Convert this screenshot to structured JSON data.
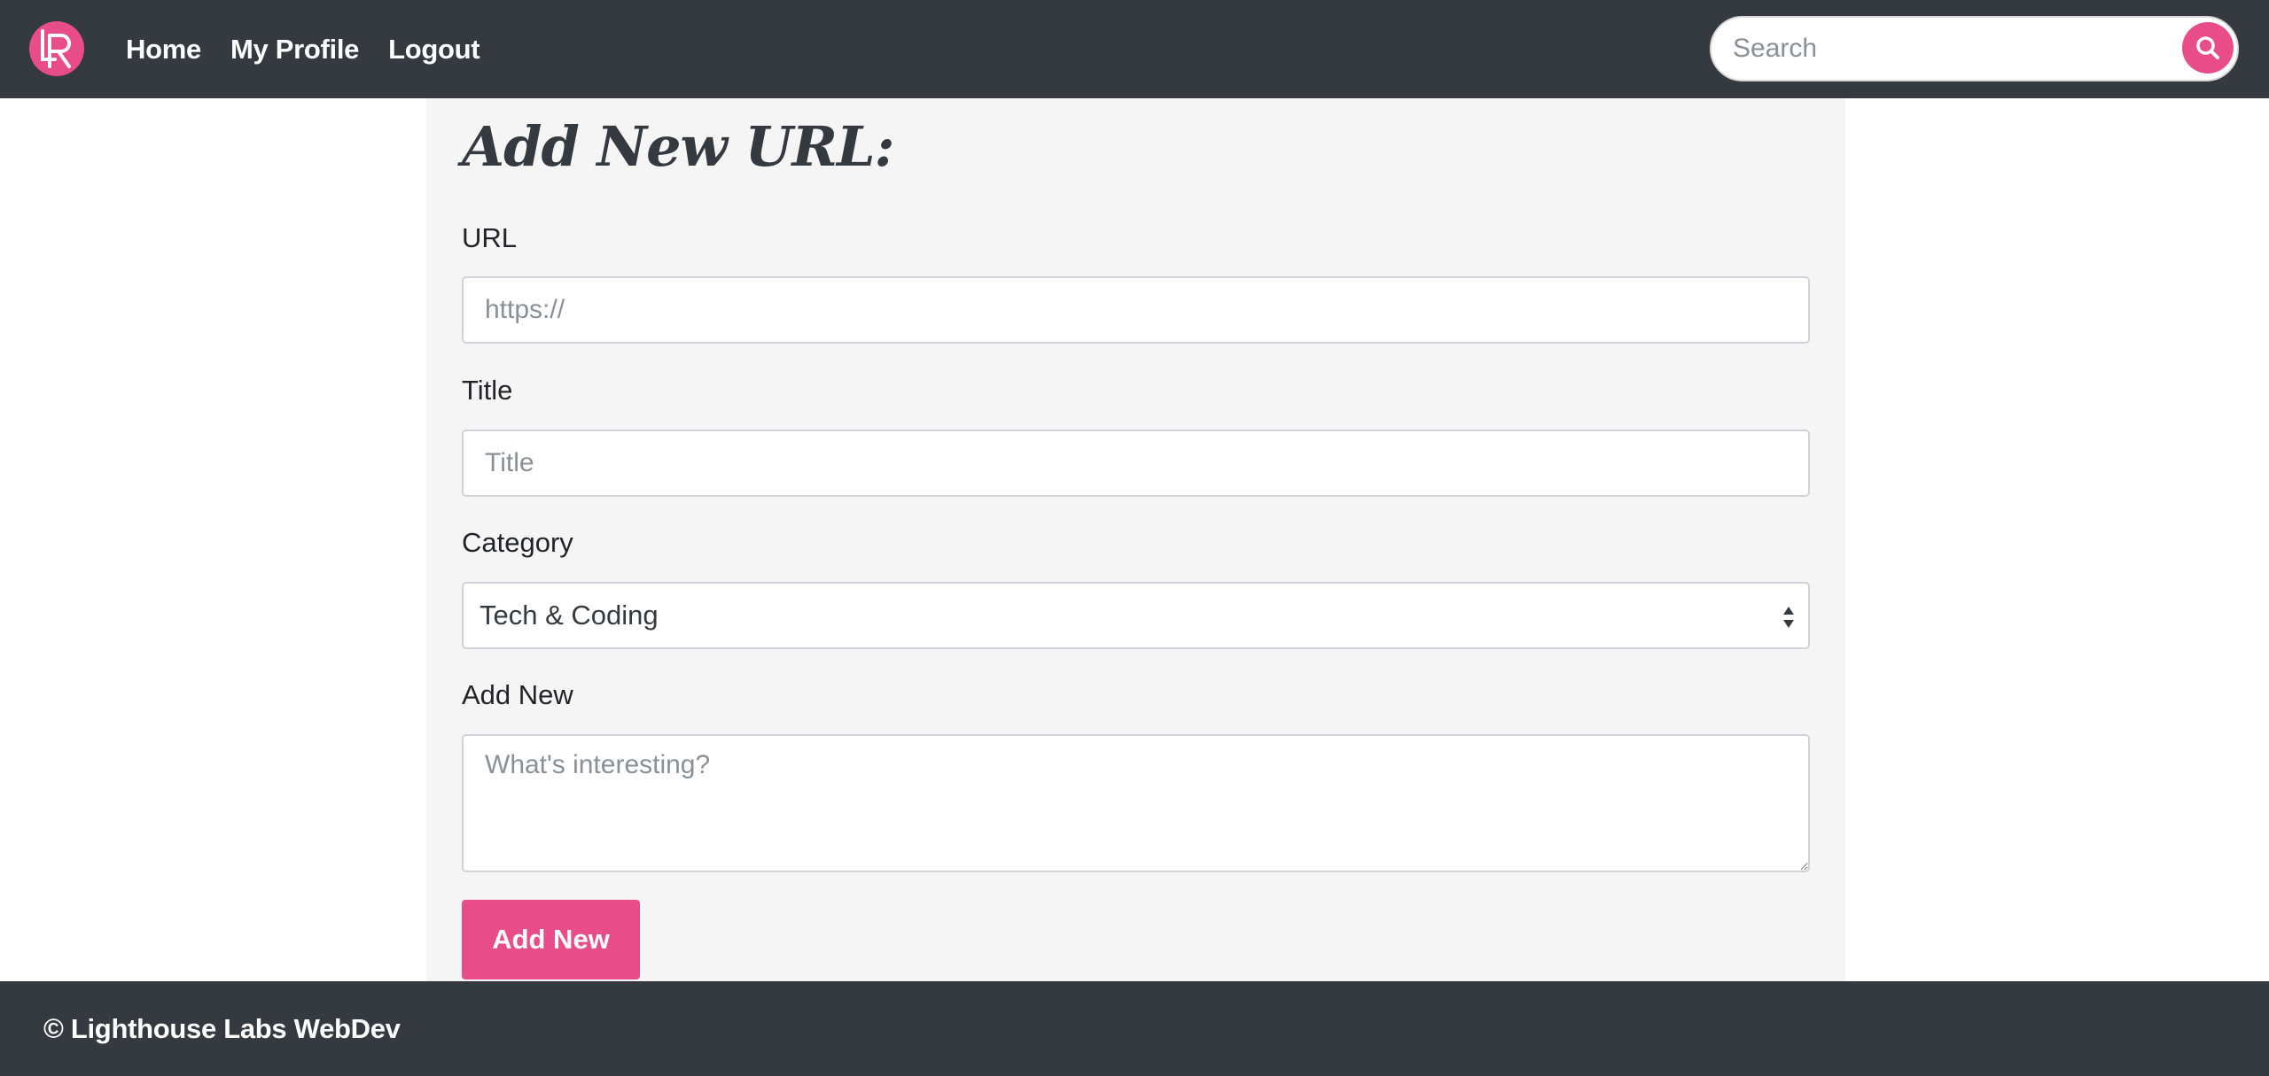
{
  "brand": {
    "logo_icon": "lr-logo-icon",
    "accent_color": "#e84d89",
    "nav_color": "#343a40"
  },
  "nav": {
    "links": [
      {
        "label": "Home"
      },
      {
        "label": "My Profile"
      },
      {
        "label": "Logout"
      }
    ]
  },
  "search": {
    "placeholder": "Search",
    "button_icon": "search-icon"
  },
  "form": {
    "title": "Add New URL:",
    "url_label": "URL",
    "url_placeholder": "https://",
    "title_label": "Title",
    "title_placeholder": "Title",
    "category_label": "Category",
    "category_value": "Tech & Coding",
    "note_label": "Add New",
    "note_placeholder": "What's interesting?",
    "submit_label": "Add New"
  },
  "footer": {
    "text": "© Lighthouse Labs WebDev"
  }
}
